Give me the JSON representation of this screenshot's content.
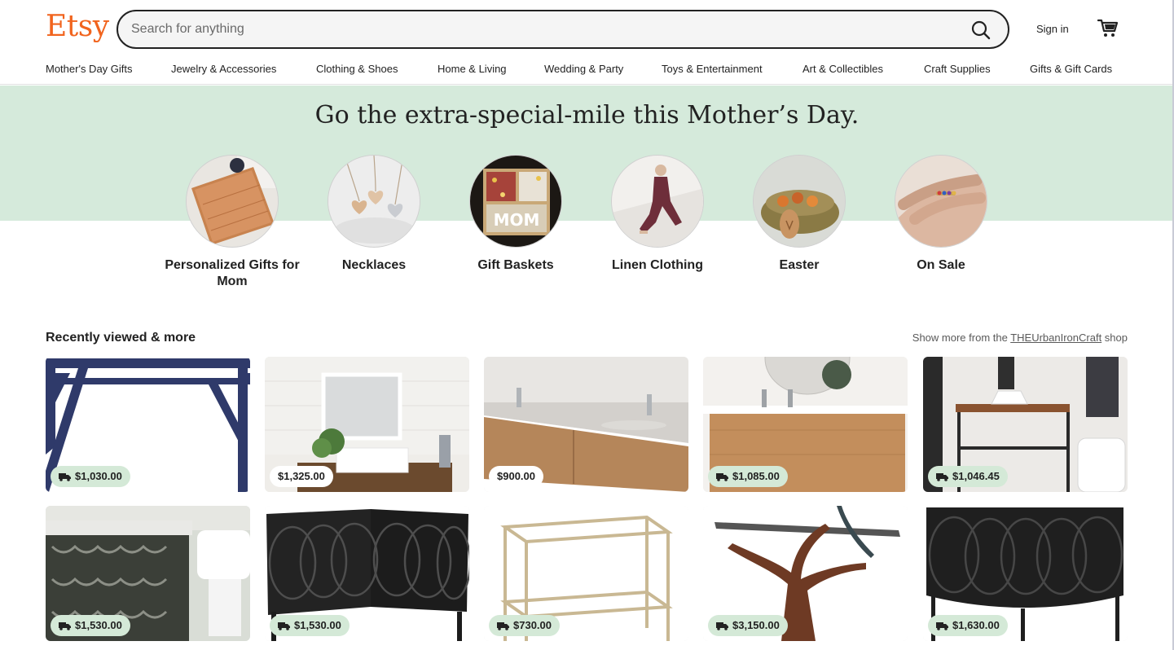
{
  "header": {
    "logo": "Etsy",
    "search_placeholder": "Search for anything",
    "signin_label": "Sign in"
  },
  "nav": {
    "categories": [
      "Mother's Day Gifts",
      "Jewelry & Accessories",
      "Clothing & Shoes",
      "Home & Living",
      "Wedding & Party",
      "Toys & Entertainment",
      "Art & Collectibles",
      "Craft Supplies",
      "Gifts & Gift Cards"
    ]
  },
  "banner": {
    "title": "Go the extra-special-mile this Mother’s Day.",
    "circles": [
      {
        "label": "Personalized Gifts for Mom"
      },
      {
        "label": "Necklaces"
      },
      {
        "label": "Gift Baskets"
      },
      {
        "label": "Linen Clothing"
      },
      {
        "label": "Easter"
      },
      {
        "label": "On Sale"
      }
    ]
  },
  "recent": {
    "title": "Recently viewed & more",
    "more_prefix": "Show more from the ",
    "shop_name": "THEUrbanIronCraft",
    "more_suffix": " shop",
    "items": [
      {
        "price": "$1,030.00",
        "free_shipping": true
      },
      {
        "price": "$1,325.00",
        "free_shipping": false
      },
      {
        "price": "$900.00",
        "free_shipping": false
      },
      {
        "price": "$1,085.00",
        "free_shipping": true
      },
      {
        "price": "$1,046.45",
        "free_shipping": true
      },
      {
        "price": "$1,530.00",
        "free_shipping": true
      },
      {
        "price": "$1,530.00",
        "free_shipping": true
      },
      {
        "price": "$730.00",
        "free_shipping": true
      },
      {
        "price": "$3,150.00",
        "free_shipping": true
      },
      {
        "price": "$1,630.00",
        "free_shipping": true
      }
    ]
  },
  "colors": {
    "brand": "#f1641e",
    "banner_bg": "#d5eadb",
    "free_shipping_badge": "#d4e9d7"
  },
  "icons": {
    "search": "search-icon",
    "cart": "cart-icon",
    "shipping": "truck-icon"
  }
}
